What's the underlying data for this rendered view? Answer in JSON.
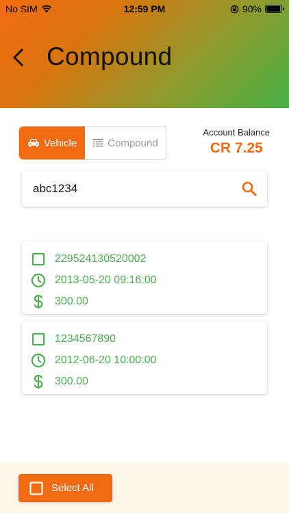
{
  "status_bar": {
    "carrier": "No SIM",
    "time": "12:59 PM",
    "battery": "90%"
  },
  "header": {
    "title": "Compound"
  },
  "tabs": [
    {
      "label": "Vehicle",
      "icon": "car-icon",
      "active": true
    },
    {
      "label": "Compound",
      "icon": "list-icon",
      "active": false
    }
  ],
  "account": {
    "label": "Account Balance",
    "value": "CR 7.25"
  },
  "search": {
    "value": "abc1234"
  },
  "records": [
    {
      "number": "229524130520002",
      "datetime": "2013-05-20 09:16:00",
      "amount": "300.00",
      "checked": false
    },
    {
      "number": "1234567890",
      "datetime": "2012-06-20 10:00:00",
      "amount": "300.00",
      "checked": false
    }
  ],
  "footer": {
    "select_all_label": "Select All"
  },
  "colors": {
    "accent": "#f26b13",
    "success": "#4caf50",
    "footer_bg": "#fef6e9"
  }
}
